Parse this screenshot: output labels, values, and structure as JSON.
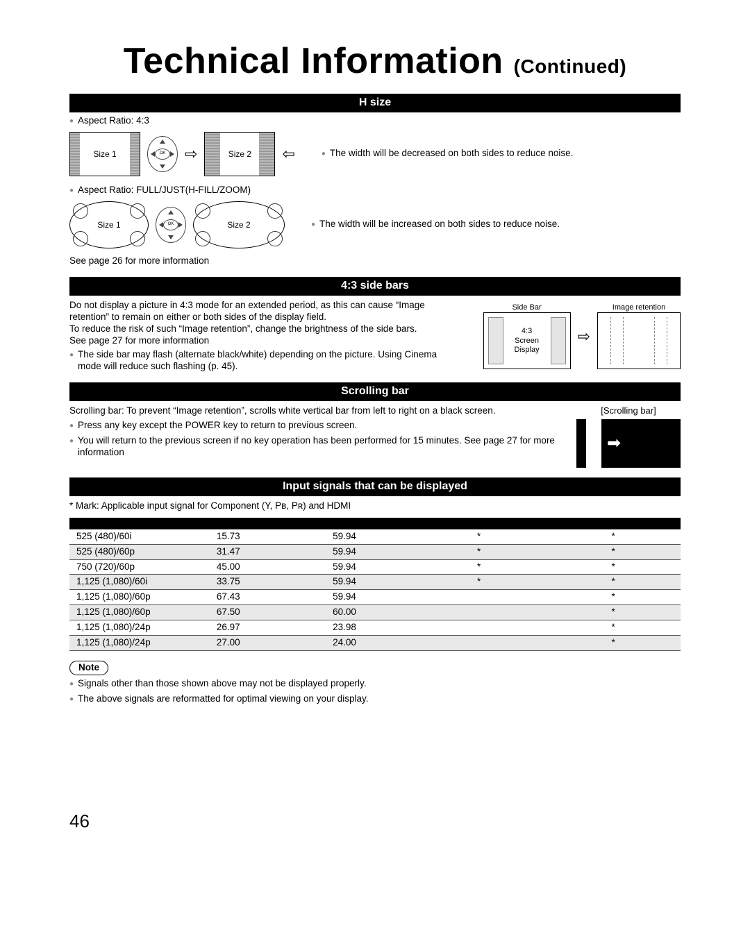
{
  "title_main": "Technical Information",
  "title_sub": "(Continued)",
  "hsize": {
    "heading": "H size",
    "aspect43": "Aspect Ratio: 4:3",
    "size1": "Size 1",
    "size2": "Size 2",
    "ok": "OK",
    "desc43": "The width will be decreased on both sides to reduce noise.",
    "aspectfull": "Aspect Ratio: FULL/JUST(H-FILL/ZOOM)",
    "descfull": "The width will be increased on both sides to reduce noise.",
    "see_page": "See page 26 for more information"
  },
  "sidebars": {
    "heading": "4:3 side bars",
    "p1": "Do not display a picture in 4:3 mode for an extended period, as this can cause “Image retention” to remain on either or both sides of the display field.",
    "p2": "To reduce the risk of such “Image retention”, change the brightness of the side bars.",
    "see_page": "See page 27 for more information",
    "b1": "The side bar may flash (alternate black/white) depending on the picture. Using Cinema mode will reduce such flashing (p. 45).",
    "fig_sidebar": "Side Bar",
    "fig_center": "4:3\nScreen\nDisplay",
    "fig_retention": "Image retention"
  },
  "scrolling": {
    "heading": "Scrolling bar",
    "desc": "Scrolling bar: To prevent “Image retention”, scrolls white vertical bar from left to right on a black screen.",
    "b1": "Press any key except the POWER key to return to previous screen.",
    "b2": "You will return to the previous screen if no key operation has been performed for 15 minutes. See page 27 for more information",
    "caption": "[Scrolling bar]"
  },
  "signals": {
    "heading": "Input signals that can be displayed",
    "footnote": "* Mark:  Applicable input signal for Component (Y, Pʙ, Pʀ) and HDMI",
    "note_label": "Note",
    "note_b1": "Signals other than those shown above may not be displayed properly.",
    "note_b2": "The above signals are reformatted for optimal viewing on your display.",
    "rows": [
      {
        "name": "525 (480)/60i",
        "h": "15.73",
        "v": "59.94",
        "c": "*",
        "d": "*",
        "alt": false
      },
      {
        "name": "525 (480)/60p",
        "h": "31.47",
        "v": "59.94",
        "c": "*",
        "d": "*",
        "alt": true
      },
      {
        "name": "750 (720)/60p",
        "h": "45.00",
        "v": "59.94",
        "c": "*",
        "d": "*",
        "alt": false
      },
      {
        "name": "1,125 (1,080)/60i",
        "h": "33.75",
        "v": "59.94",
        "c": "*",
        "d": "*",
        "alt": true
      },
      {
        "name": "1,125 (1,080)/60p",
        "h": "67.43",
        "v": "59.94",
        "c": "",
        "d": "*",
        "alt": false
      },
      {
        "name": "1,125 (1,080)/60p",
        "h": "67.50",
        "v": "60.00",
        "c": "",
        "d": "*",
        "alt": true
      },
      {
        "name": "1,125 (1,080)/24p",
        "h": "26.97",
        "v": "23.98",
        "c": "",
        "d": "*",
        "alt": false
      },
      {
        "name": "1,125 (1,080)/24p",
        "h": "27.00",
        "v": "24.00",
        "c": "",
        "d": "*",
        "alt": true
      }
    ]
  },
  "page_number": "46"
}
